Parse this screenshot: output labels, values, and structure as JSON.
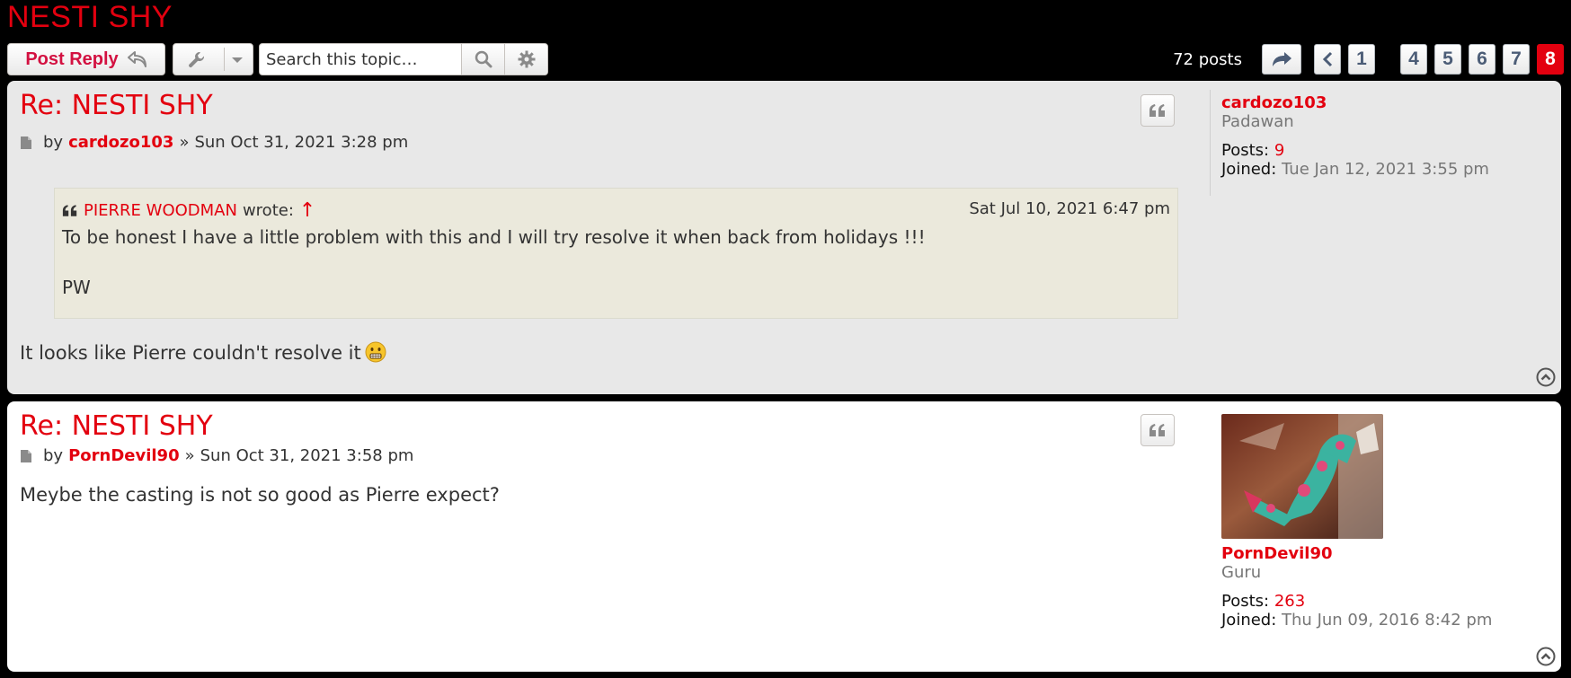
{
  "topic": {
    "title": "NESTI SHY"
  },
  "action_bar": {
    "post_reply_label": "Post Reply",
    "tools_icon": "wrench-icon",
    "search_placeholder": "Search this topic…",
    "post_count": "72 posts",
    "pages": [
      "1",
      "4",
      "5",
      "6",
      "7",
      "8"
    ],
    "active_page": "8"
  },
  "posts": [
    {
      "title": "Re: NESTI SHY",
      "by": "by",
      "author": "cardozo103",
      "sep": "»",
      "date": "Sun Oct 31, 2021 3:28 pm",
      "quote": {
        "author": "PIERRE WOODMAN",
        "wrote": "wrote:",
        "arrow": "↑",
        "date": "Sat Jul 10, 2021 6:47 pm",
        "line1": "To be honest I have a little problem with this and I will try resolve it when back from holidays !!!",
        "line2": "PW"
      },
      "body": "It looks like Pierre couldn't resolve it",
      "profile": {
        "name": "cardozo103",
        "rank": "Padawan",
        "posts_label": "Posts:",
        "posts": "9",
        "joined_label": "Joined:",
        "joined": "Tue Jan 12, 2021 3:55 pm"
      }
    },
    {
      "title": "Re: NESTI SHY",
      "by": "by",
      "author": "PornDevil90",
      "sep": "»",
      "date": "Sun Oct 31, 2021 3:58 pm",
      "body": "Meybe the casting is not so good as Pierre expect?",
      "profile": {
        "name": "PornDevil90",
        "rank": "Guru",
        "posts_label": "Posts:",
        "posts": "263",
        "joined_label": "Joined:",
        "joined": "Thu Jun 09, 2016 8:42 pm"
      }
    }
  ],
  "colors": {
    "accent": "#e3000f",
    "post_bg_alt": "#e8e8e8",
    "quote_bg": "#ebe9dc"
  }
}
